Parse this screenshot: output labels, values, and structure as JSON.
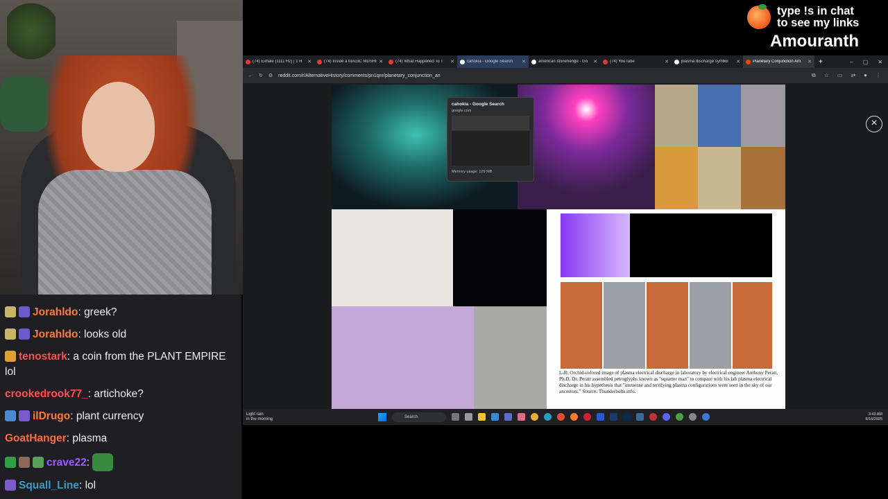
{
  "overlay": {
    "promo_line1": "type !s in chat",
    "promo_line2": "to see my links",
    "streamer_name": "Amouranth"
  },
  "chat": {
    "messages": [
      {
        "user": "Jorahldo",
        "text": ": greek?",
        "color": "#ff7b3a"
      },
      {
        "user": "Jorahldo",
        "text": ": looks old",
        "color": "#ff7b3a"
      },
      {
        "user": "tenostark",
        "text": ": a coin from the PLANT EMPIRE lol",
        "color": "#ff4f4f"
      },
      {
        "user": "crookedrook77_",
        "text": ": artichoke?",
        "color": "#ff4f4f"
      },
      {
        "user": "ilDrugo",
        "text": ": plant currency",
        "color": "#ff7b3a"
      },
      {
        "user": "GoatHanger",
        "text": ": plasma",
        "color": "#ff6b3a"
      },
      {
        "user": "crave22",
        "text": ":",
        "color": "#9c5cff"
      },
      {
        "user": "Squall_Line",
        "text": ": lol",
        "color": "#3a9ac8"
      }
    ]
  },
  "browser": {
    "tabs": [
      {
        "label": "(74) Exhale (1111 Hz) | 1 H",
        "icon": "youtube-icon",
        "color": "#e53935"
      },
      {
        "label": "(74) Inside a MAGIC MUSHR",
        "icon": "youtube-icon",
        "color": "#e53935"
      },
      {
        "label": "(74) What Happened To T",
        "icon": "youtube-icon",
        "color": "#e53935"
      },
      {
        "label": "cahokia - Google Search",
        "icon": "google-icon",
        "color": "#ffffff"
      },
      {
        "label": "american stonehenge - Go",
        "icon": "google-icon",
        "color": "#ffffff"
      },
      {
        "label": "(74) YouTube",
        "icon": "youtube-icon",
        "color": "#e53935"
      },
      {
        "label": "plasma discharge symbol",
        "icon": "google-icon",
        "color": "#ffffff"
      },
      {
        "label": "Planetary Conjunction Am",
        "icon": "reddit-icon",
        "color": "#ff4500"
      }
    ],
    "url": "reddit.com/r/AlternativeHistory/comments/pn1qnr/planetary_conjunction_an",
    "close_label": "×",
    "new_tab": "+",
    "window_controls": [
      "–",
      "▢",
      "✕"
    ],
    "tab_preview": {
      "title": "cahokia - Google Search",
      "domain": "google.com",
      "memory": "Memory usage: 129 MB"
    },
    "caption": "L-R: Orchid-colored image of plasma electrical discharge in laboratory by electrical engineer Anthony Peratt, Ph.D. Dr. Peratt assembled petroglyphs known as \"squatter man\" to compare with his lab plasma electrical discharge in his hypothesis that \"immense and terrifying plasma configurations were seen in the sky of our ancestors.\" Source: Thunderbolts.info."
  },
  "taskbar": {
    "weather_line1": "Light rain",
    "weather_line2": "in the morning",
    "search_placeholder": "Search",
    "time": "3:43 AM",
    "date": "8/16/2025"
  }
}
